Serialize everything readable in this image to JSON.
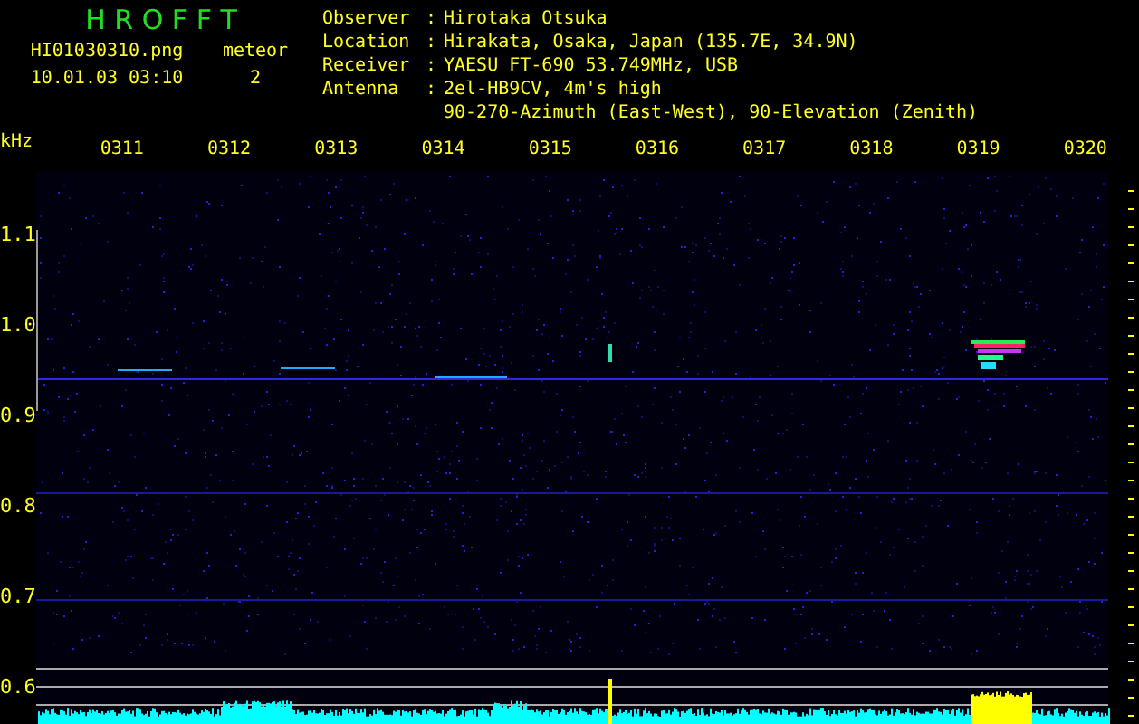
{
  "app": {
    "title": "H R O F F T",
    "file": "HI01030310.png",
    "datetime": "10.01.03 03:10",
    "meteor_label": "meteor",
    "meteor_count": "2"
  },
  "info": [
    {
      "label": "Observer",
      "separator": ":",
      "value": "Hirotaka Otsuka"
    },
    {
      "label": "Location",
      "separator": ":",
      "value": "Hirakata, Osaka, Japan (135.7E, 34.9N)"
    },
    {
      "label": "Receiver",
      "separator": ":",
      "value": "YAESU FT-690 53.749MHz, USB"
    },
    {
      "label": "Antenna",
      "separator": ":",
      "value": "2el-HB9CV, 4m's high"
    },
    {
      "value": "90-270-Azimuth (East-West), 90-Elevation (Zenith)"
    }
  ],
  "spectrogram": {
    "unit": "kHz",
    "time_labels": [
      "0311",
      "0312",
      "0313",
      "0314",
      "0315",
      "0316",
      "0317",
      "0318",
      "0319",
      "0320"
    ],
    "freq_labels": [
      "1.1",
      "1.0",
      "0.9",
      "0.8",
      "0.7",
      "0.6"
    ]
  }
}
